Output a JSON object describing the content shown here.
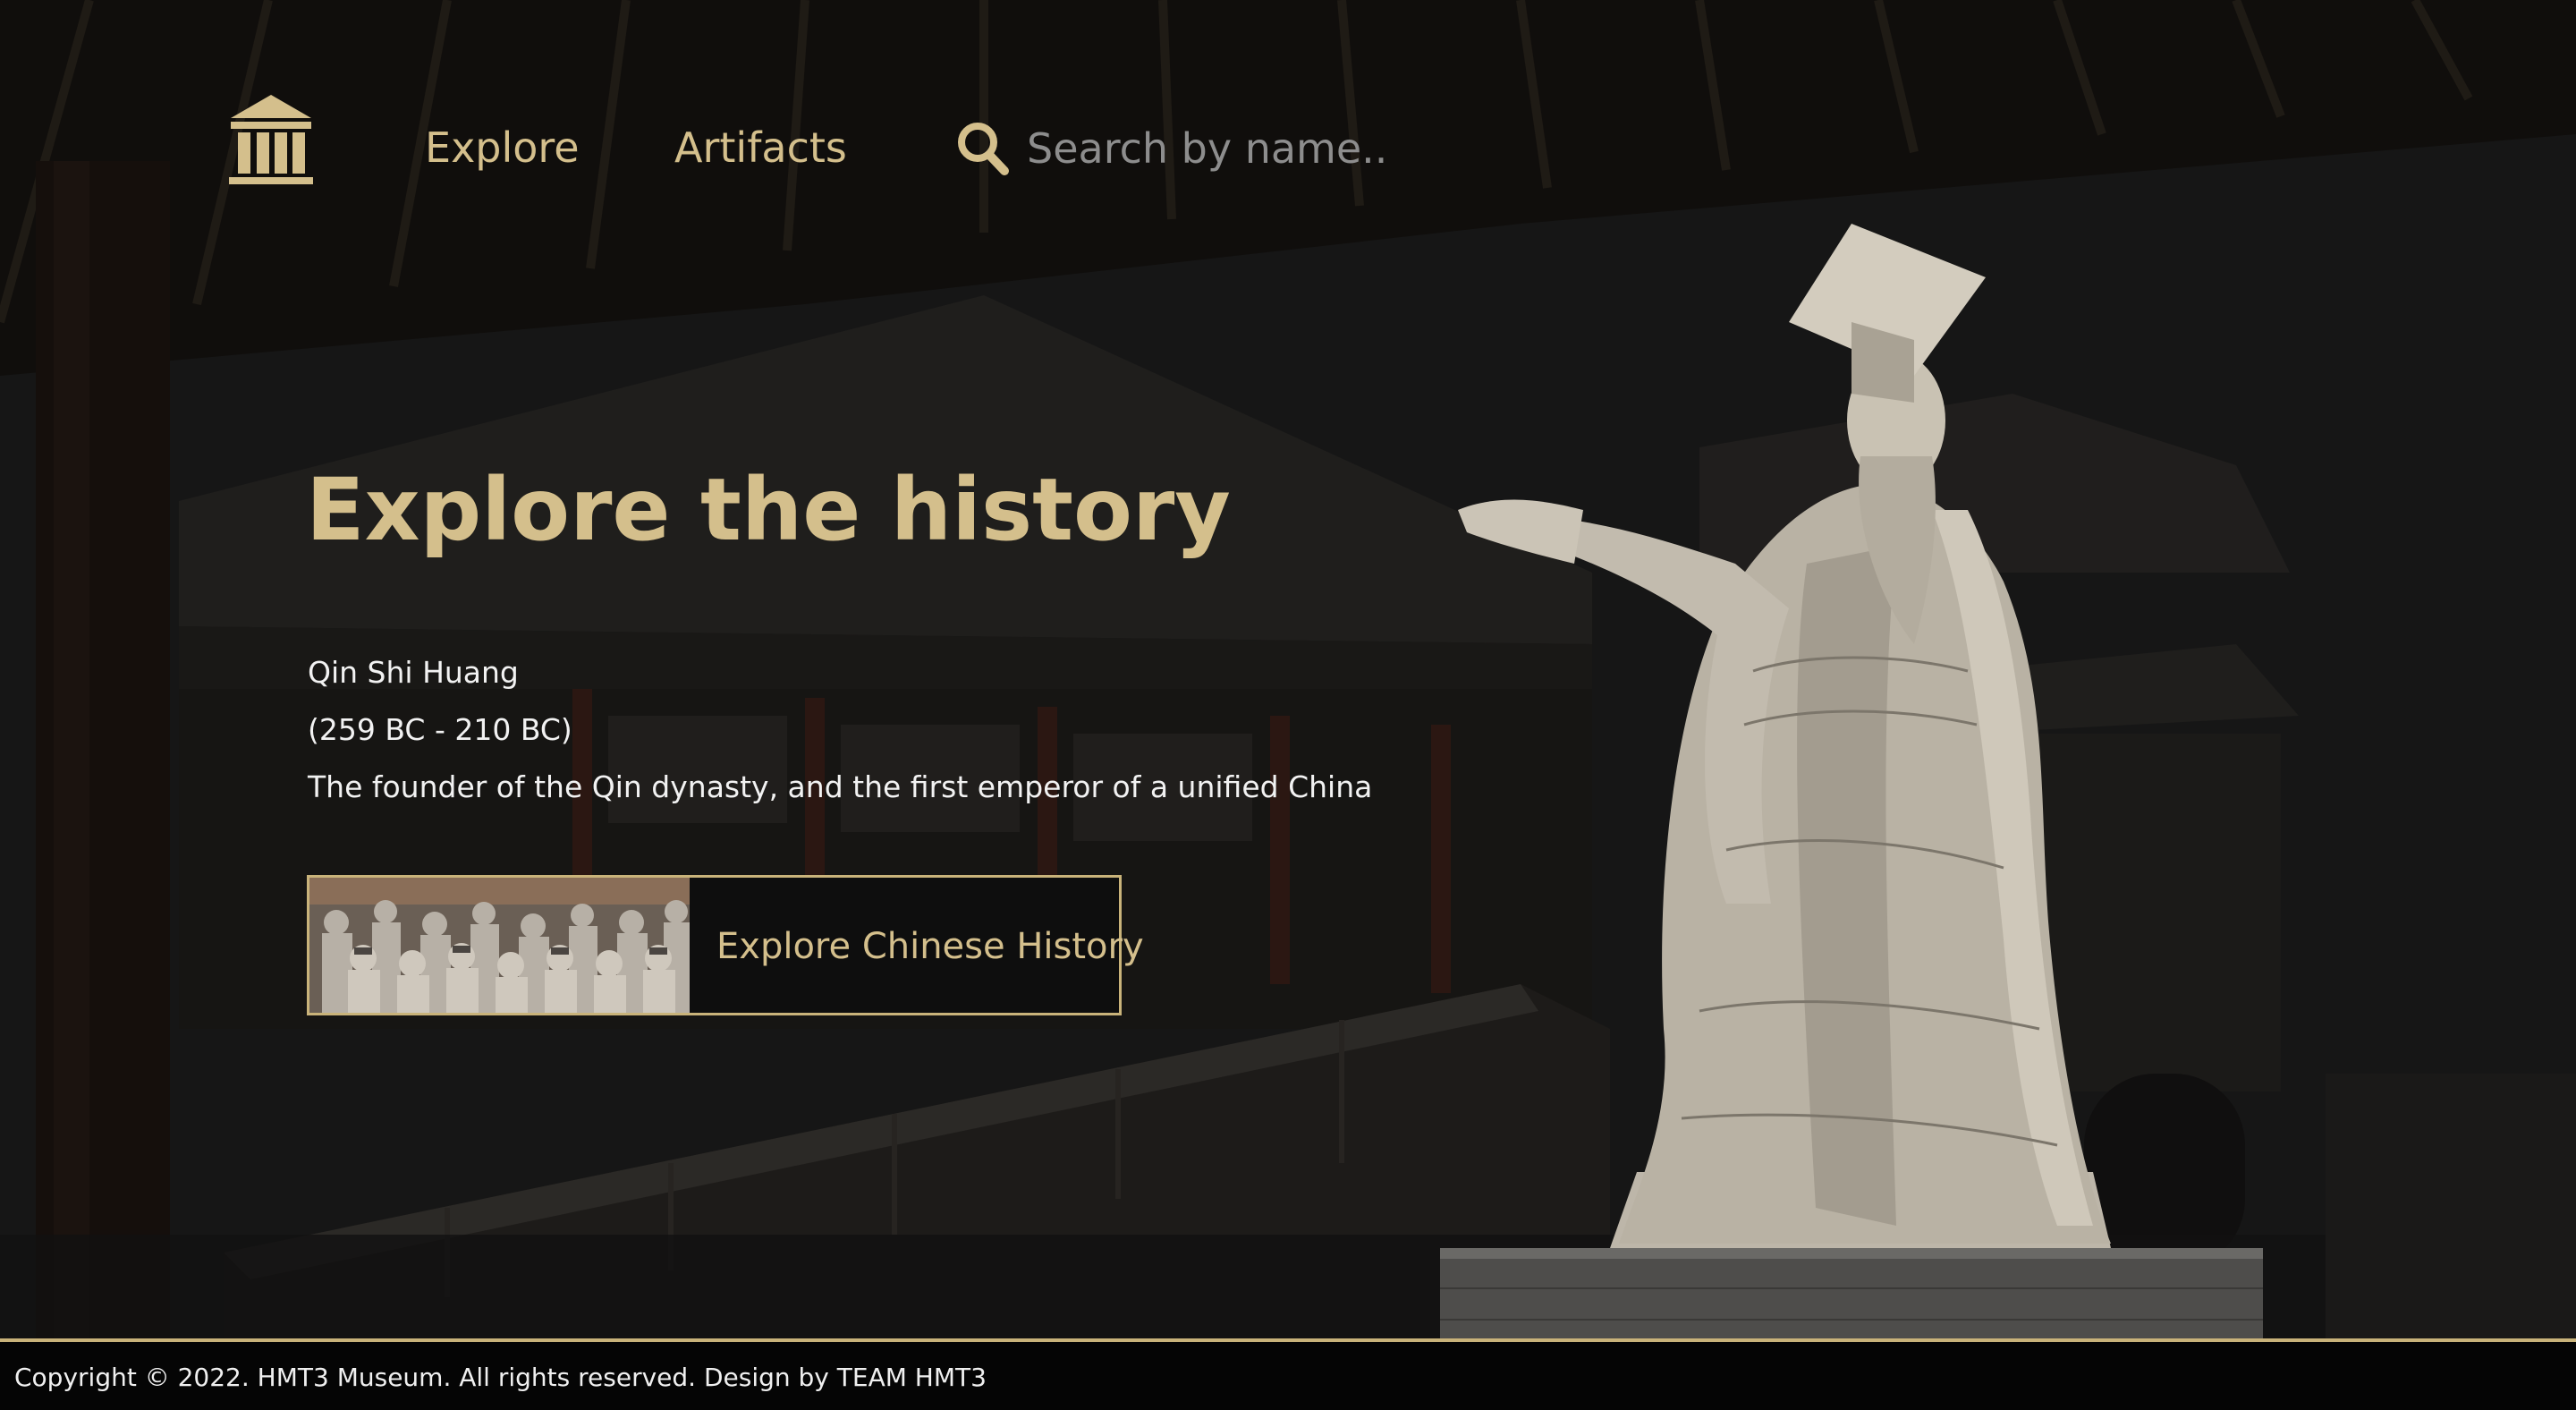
{
  "nav": {
    "logo_icon": "museum-building-icon",
    "explore_label": "Explore",
    "artifacts_label": "Artifacts",
    "search_icon": "search-icon",
    "search_placeholder": "Search by name.."
  },
  "hero": {
    "title": "Explore the history",
    "name": "Qin Shi Huang",
    "years": "(259 BC - 210 BC)",
    "description": "The founder of the Qin dynasty, and the first emperor of a unified China"
  },
  "cta": {
    "label": "Explore Chinese History",
    "thumbnail": "terracotta-warriors-image"
  },
  "footer": {
    "text": "Copyright © 2022. HMT3 Museum. All rights reserved. Design by TEAM HMT3"
  },
  "colors": {
    "accent": "#d4bf8c",
    "background": "#1c1c1c",
    "footer_bg": "#050505",
    "text": "#f2f2f2"
  }
}
